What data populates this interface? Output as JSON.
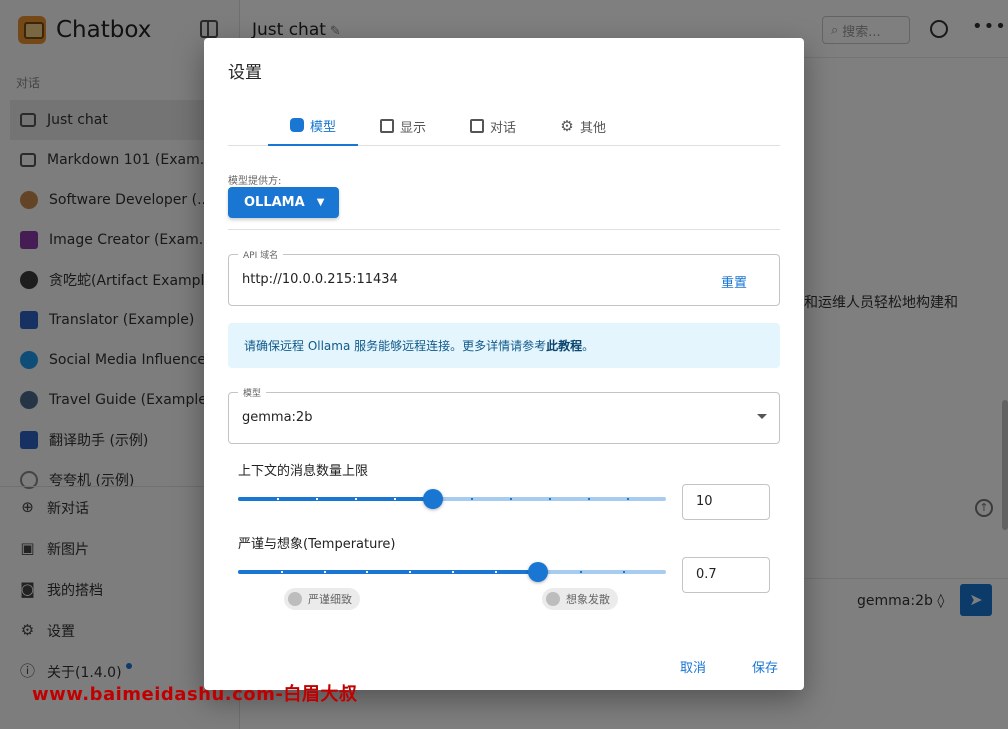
{
  "sidebar": {
    "app_name": "Chatbox",
    "section_label": "对话",
    "sessions": [
      {
        "label": "Just chat",
        "icon": "chat-bubble-icon",
        "active": true
      },
      {
        "label": "Markdown 101 (Exam...",
        "icon": "chat-bubble-icon"
      },
      {
        "label": "Software Developer (...",
        "icon": "developer-avatar-icon"
      },
      {
        "label": "Image Creator (Exam...",
        "icon": "image-icon"
      },
      {
        "label": "贪吃蛇(Artifact Example)",
        "icon": "snake-game-icon"
      },
      {
        "label": "Translator (Example)",
        "icon": "translator-icon"
      },
      {
        "label": "Social Media Influencer (E",
        "icon": "twitter-icon"
      },
      {
        "label": "Travel Guide (Example)",
        "icon": "globe-icon"
      },
      {
        "label": "翻译助手 (示例)",
        "icon": "translator-icon"
      },
      {
        "label": "夸夸机 (示例)",
        "icon": "timer-icon"
      }
    ],
    "nav": {
      "new_chat": "新对话",
      "new_image": "新图片",
      "my_partners": "我的搭档",
      "settings": "设置",
      "about": "关于(1.4.0)"
    }
  },
  "main": {
    "chat_title": "Just chat",
    "search_placeholder": "搜索...",
    "background_text": "吗和运维人员轻松地构建和",
    "model_picker": "gemma:2b ◊"
  },
  "dialog": {
    "title": "设置",
    "tabs": [
      {
        "label": "模型",
        "icon": "robot-icon",
        "active": true
      },
      {
        "label": "显示",
        "icon": "display-icon"
      },
      {
        "label": "对话",
        "icon": "message-icon"
      },
      {
        "label": "其他",
        "icon": "gear-icon"
      }
    ],
    "provider_label": "模型提供方:",
    "provider_value": "OLLAMA",
    "api_host_label": "API 域名",
    "api_host_value": "http://10.0.0.215:11434",
    "reset_label": "重置",
    "alert_text": "请确保远程 Ollama 服务能够远程连接。更多详情请参考",
    "alert_link": "此教程",
    "alert_end": "。",
    "model_label": "模型",
    "model_value": "gemma:2b",
    "context_label": "上下文的消息数量上限",
    "context_value": "10",
    "context_fraction": 0.455,
    "temperature_label": "严谨与想象(Temperature)",
    "temperature_value": "0.7",
    "temperature_fraction": 0.7,
    "chip_strict": "严谨细致",
    "chip_creative": "想象发散",
    "cancel_label": "取消",
    "save_label": "保存"
  },
  "watermark": "www.baimeidashu.com-白眉大叔",
  "colors": {
    "accent": "#1976d2",
    "alert_bg": "#e5f5fd",
    "overlay": "rgba(0,0,0,0.5)"
  }
}
